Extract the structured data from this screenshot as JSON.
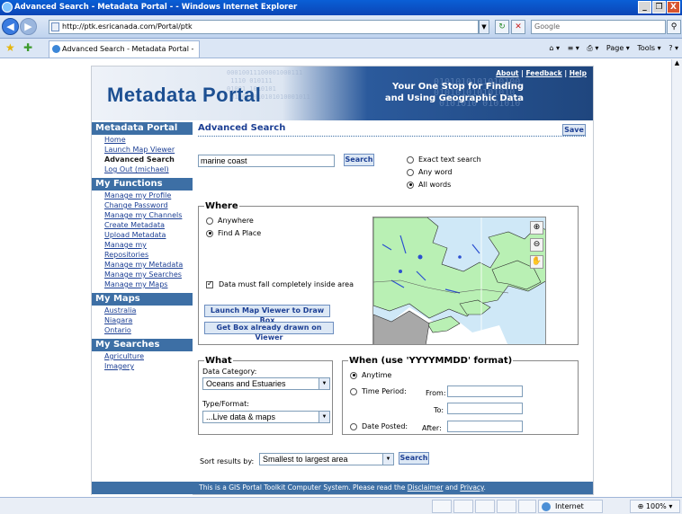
{
  "window": {
    "title": "Advanced Search - Metadata Portal - - Windows Internet Explorer",
    "buttons": [
      "_",
      "❐",
      "X"
    ]
  },
  "browser": {
    "address": "http://ptk.esricanada.com/Portal/ptk",
    "search_placeholder": "Google",
    "tab_title": "Advanced Search - Metadata Portal -",
    "tools": [
      "Page ▾",
      "Tools ▾"
    ]
  },
  "banner": {
    "logo": "Metadata Portal",
    "tagline_line1": "Your One Stop for Finding",
    "tagline_line2": "and Using Geographic Data",
    "links": {
      "about": "About",
      "feedback": "Feedback",
      "help": "Help"
    },
    "bits_left": "00010011100001000111\n 1110 010111\n01001 1010101\n 010011010101010001011",
    "bits_right": "0101010101010100\n010101010101010\n 0101010 0101010"
  },
  "sidebar": {
    "sections": [
      {
        "title": "Metadata Portal",
        "items": [
          "Home",
          "Launch Map Viewer",
          "Advanced Search",
          "Log Out (michael)"
        ]
      },
      {
        "title": "My Functions",
        "items": [
          "Manage my Profile",
          "Change Password",
          "Manage my Channels",
          "Create Metadata",
          "Upload Metadata",
          "Manage my Repositories",
          "Manage my Metadata",
          "Manage my Searches",
          "Manage my Maps"
        ]
      },
      {
        "title": "My Maps",
        "items": [
          "Australia",
          "Niagara",
          "Ontario"
        ]
      },
      {
        "title": "My Searches",
        "items": [
          "Agriculture",
          "Imagery"
        ]
      }
    ]
  },
  "main": {
    "heading": "Advanced Search",
    "save_label": "Save",
    "search_value": "marine coast",
    "search_button": "Search",
    "text_options": [
      "Exact text search",
      "Any word",
      "All words"
    ],
    "text_option_selected": "All words",
    "where": {
      "legend": "Where",
      "options": [
        "Anywhere",
        "Find A Place"
      ],
      "selected": "Find A Place",
      "checkbox_label": "Data must fall completely inside area",
      "checkbox_checked": true,
      "launch_button": "Launch Map Viewer to Draw Box",
      "getbox_button": "Get Box already drawn on Viewer"
    },
    "what": {
      "legend": "What",
      "category_label": "Data Category:",
      "category_value": "Oceans and Estuaries",
      "type_label": "Type/Format:",
      "type_value": "...Live data & maps"
    },
    "when": {
      "legend": "When (use 'YYYYMMDD' format)",
      "anytime": "Anytime",
      "time_period": "Time Period:",
      "from": "From:",
      "to": "To:",
      "date_posted": "Date Posted:",
      "after": "After:",
      "selected": "Anytime"
    },
    "sort_label": "Sort results by:",
    "sort_value": "Smallest to largest area",
    "sort_button": "Search"
  },
  "footer": {
    "text": "This is a GIS Portal Toolkit Computer System. Please read the",
    "disclaimer": "Disclaimer",
    "and": "and",
    "privacy": "Privacy",
    "period": "."
  },
  "statusbar": {
    "zone": "Internet",
    "zoom": "100%"
  }
}
